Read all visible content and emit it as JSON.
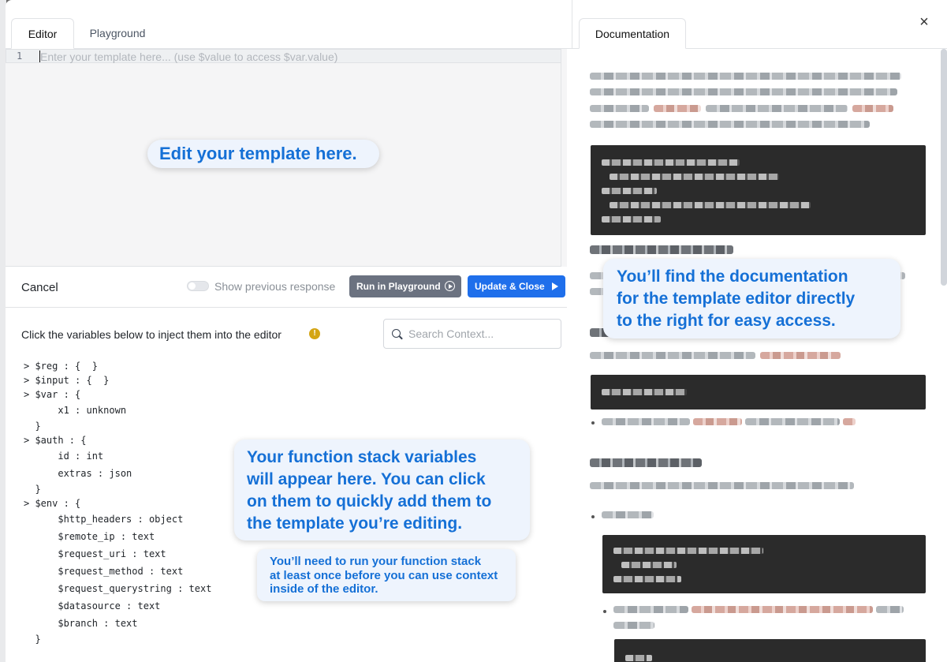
{
  "tabs": {
    "editor": "Editor",
    "playground": "Playground"
  },
  "editor": {
    "line_number": "1",
    "placeholder": "Enter your template here... (use $value to access $var.value)"
  },
  "toolbar": {
    "cancel": "Cancel",
    "show_previous": "Show previous response",
    "run": "Run in Playground",
    "update": "Update & Close"
  },
  "context": {
    "title": "Click the variables below to inject them into the editor",
    "warning_glyph": "!",
    "search_placeholder": "Search Context...",
    "tree": [
      "> $reg : {  }",
      "> $input : {  }",
      "> $var : {",
      "      x1 : unknown",
      "  }",
      "> $auth : {",
      "      id : int",
      "      extras : json",
      "  }",
      "> $env : {",
      "      $http_headers : object",
      "      $remote_ip : text",
      "      $request_uri : text",
      "      $request_method : text",
      "      $request_querystring : text",
      "      $datasource : text",
      "      $branch : text",
      "  }"
    ]
  },
  "documentation": {
    "tab": "Documentation",
    "close": "×"
  },
  "callouts": {
    "editor_hint": "Edit your template here.",
    "variables_hint": "Your function stack variables\nwill appear here. You can click\non them to quickly add them to\nthe template you’re editing.",
    "run_hint": "You’ll need to run your function stack\nat least once before you can use context\ninside of the editor.",
    "docs_hint": "You’ll find the documentation\nfor the template editor directly\nto the right for easy access."
  },
  "colors": {
    "accent": "#1f6feb",
    "callout_text": "#1570d6",
    "callout_bg": "#eef4fd",
    "run_button": "#6b7280"
  }
}
